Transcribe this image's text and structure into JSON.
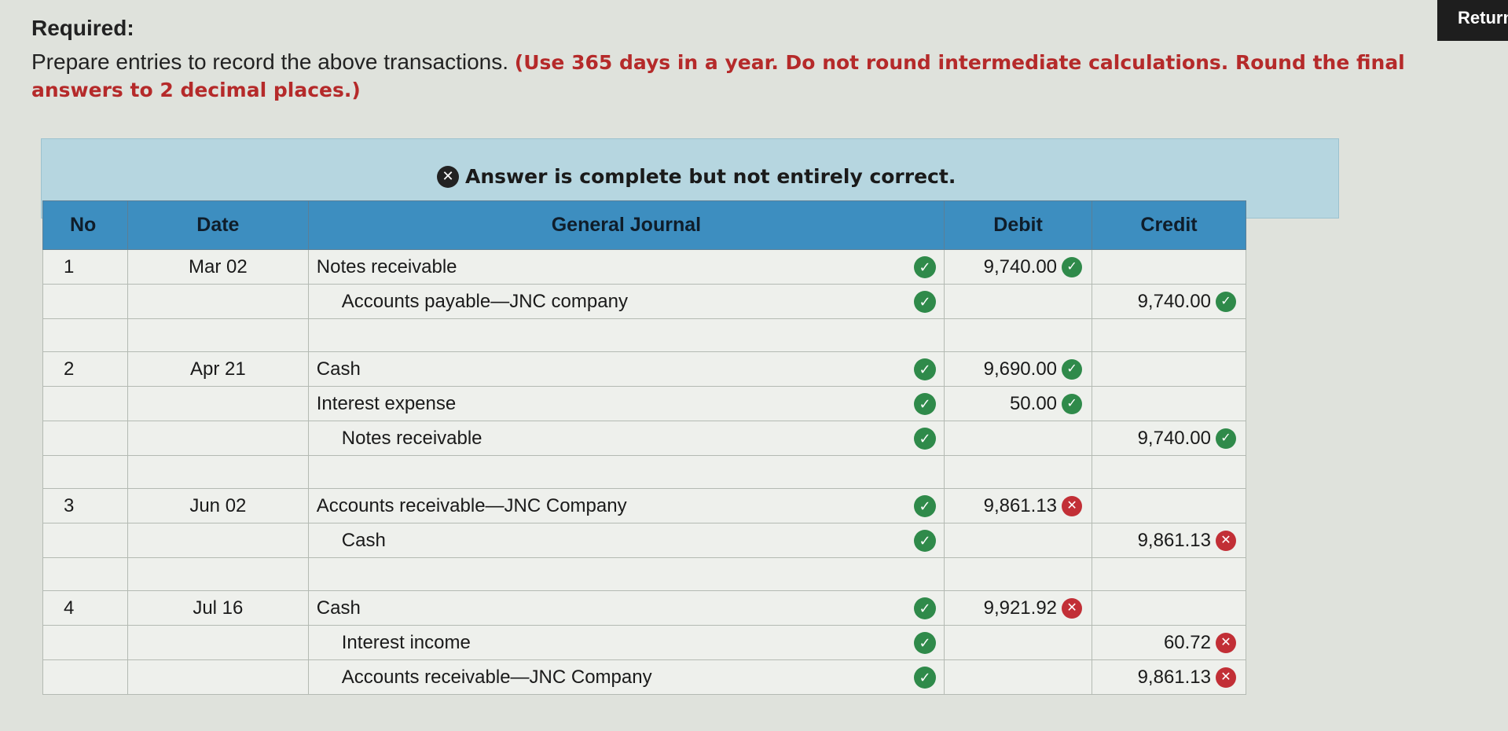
{
  "header": {
    "return_label": "Return",
    "required_label": "Required:",
    "instruction_text": "Prepare entries to record the above transactions. ",
    "instruction_note": "(Use 365 days in a year. Do not round intermediate calculations. Round the final answers to 2 decimal places.)"
  },
  "answer_status": {
    "text": "Answer is complete but not entirely correct.",
    "icon": "x-circle-icon"
  },
  "table": {
    "headers": {
      "no": "No",
      "date": "Date",
      "journal": "General Journal",
      "debit": "Debit",
      "credit": "Credit"
    },
    "rows": [
      {
        "no": "1",
        "date": "Mar 02",
        "account": "Notes receivable",
        "debit": "9,740.00",
        "debit_status": "correct",
        "credit": "",
        "credit_status": ""
      },
      {
        "no": "",
        "date": "",
        "account": "Accounts payable—JNC company",
        "debit": "",
        "debit_status": "",
        "credit": "9,740.00",
        "credit_status": "correct"
      },
      {
        "no": "2",
        "date": "Apr 21",
        "account": "Cash",
        "debit": "9,690.00",
        "debit_status": "correct",
        "credit": "",
        "credit_status": ""
      },
      {
        "no": "",
        "date": "",
        "account": "Interest expense",
        "debit": "50.00",
        "debit_status": "correct",
        "credit": "",
        "credit_status": ""
      },
      {
        "no": "",
        "date": "",
        "account": "Notes receivable",
        "debit": "",
        "debit_status": "",
        "credit": "9,740.00",
        "credit_status": "correct"
      },
      {
        "no": "3",
        "date": "Jun 02",
        "account": "Accounts receivable—JNC Company",
        "debit": "9,861.13",
        "debit_status": "incorrect",
        "credit": "",
        "credit_status": ""
      },
      {
        "no": "",
        "date": "",
        "account": "Cash",
        "debit": "",
        "debit_status": "",
        "credit": "9,861.13",
        "credit_status": "incorrect"
      },
      {
        "no": "4",
        "date": "Jul 16",
        "account": "Cash",
        "debit": "9,921.92",
        "debit_status": "incorrect",
        "credit": "",
        "credit_status": ""
      },
      {
        "no": "",
        "date": "",
        "account": "Interest income",
        "debit": "",
        "debit_status": "",
        "credit": "60.72",
        "credit_status": "incorrect"
      },
      {
        "no": "",
        "date": "",
        "account": "Accounts receivable—JNC Company",
        "debit": "",
        "debit_status": "",
        "credit": "9,861.13",
        "credit_status": "incorrect"
      }
    ]
  },
  "colors": {
    "header_blue": "#3d8ec0",
    "panel_blue": "#b6d6e0",
    "correct_green": "#2f8a4a",
    "incorrect_red": "#c22f36",
    "note_red": "#b52a2a"
  }
}
